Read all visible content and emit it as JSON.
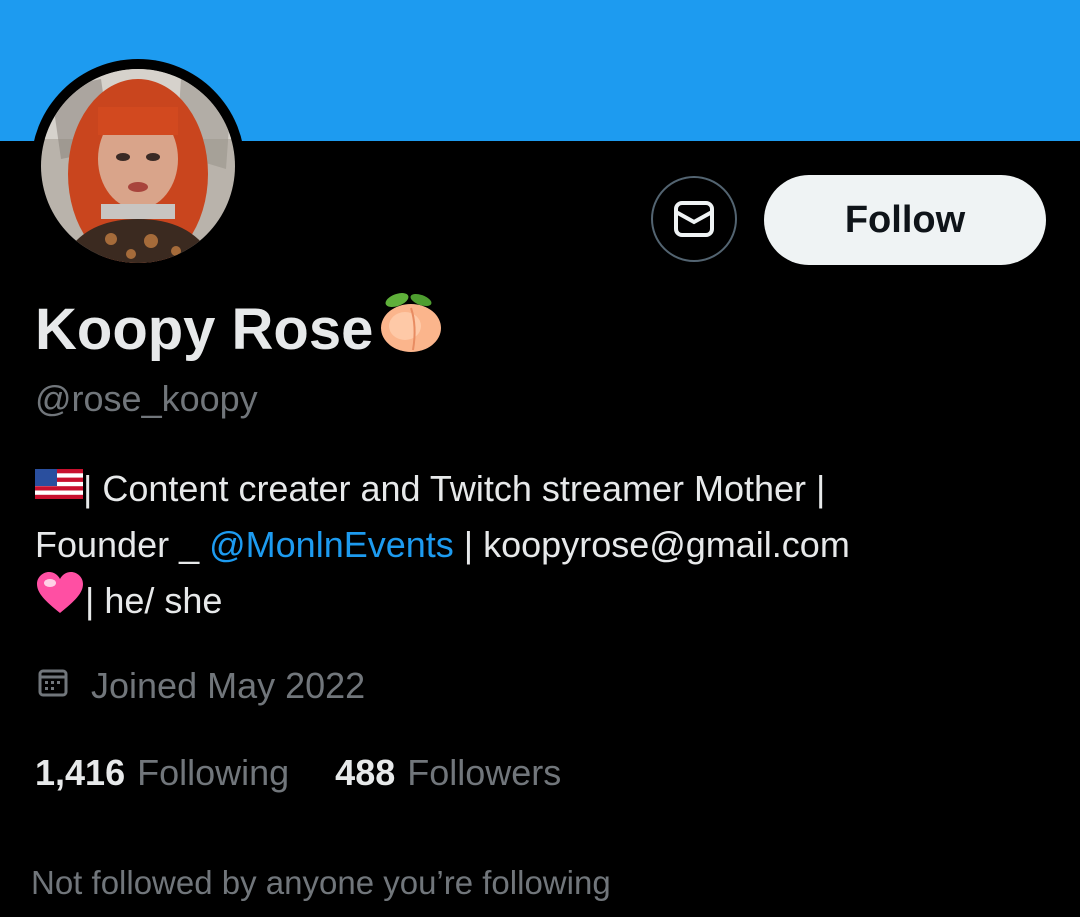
{
  "profile": {
    "display_name": "Koopy Rose",
    "name_emoji": "peach-emoji",
    "handle": "@rose_koopy",
    "avatar": "profile-photo"
  },
  "actions": {
    "message_icon": "envelope-icon",
    "follow_label": "Follow"
  },
  "bio": {
    "line1_flag": "us-flag-emoji",
    "line1_text": "| Content creater and Twitch streamer Mother |",
    "line2_prefix": "Founder _ ",
    "line2_mention": "@MonlnEvents",
    "line2_suffix": " | koopyrose@gmail.com",
    "line3_heart": "pink-heart-emoji",
    "line3_text": "| he/ she"
  },
  "joined": {
    "icon": "calendar-icon",
    "text": "Joined May 2022"
  },
  "stats": {
    "following_count": "1,416",
    "following_label": "Following",
    "followers_count": "488",
    "followers_label": "Followers"
  },
  "footer": {
    "not_followed_text": "Not followed by anyone you’re following"
  },
  "colors": {
    "banner": "#1d9bf0",
    "background": "#000000",
    "primary_text": "#e7e9ea",
    "secondary_text": "#71767b",
    "link": "#1d9bf0",
    "follow_button_bg": "#eff3f4"
  }
}
